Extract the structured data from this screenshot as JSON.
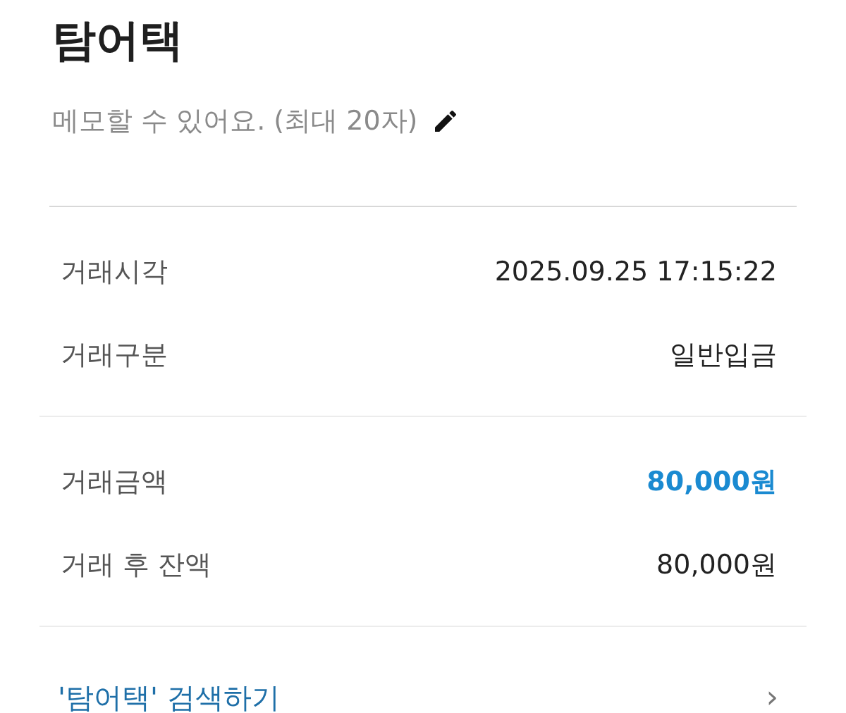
{
  "title": "탐어택",
  "memo": {
    "placeholder": "메모할 수 있어요. (최대 20자)"
  },
  "sections": [
    {
      "rows": [
        {
          "label": "거래시각",
          "value": "2025.09.25 17:15:22",
          "highlight": false
        },
        {
          "label": "거래구분",
          "value": "일반입금",
          "highlight": false
        }
      ]
    },
    {
      "rows": [
        {
          "label": "거래금액",
          "value": "80,000원",
          "highlight": true
        },
        {
          "label": "거래 후 잔액",
          "value": "80,000원",
          "highlight": false
        }
      ]
    }
  ],
  "link": {
    "label": "'탐어택' 검색하기",
    "chevron": "›"
  }
}
